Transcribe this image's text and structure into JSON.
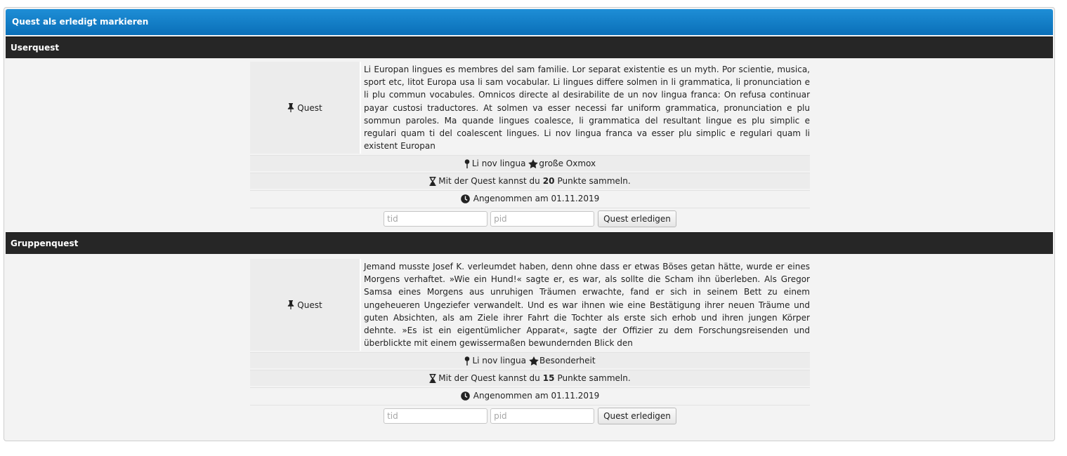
{
  "panel": {
    "title": "Quest als erledigt markieren"
  },
  "sections": [
    {
      "heading": "Userquest",
      "label": "Quest",
      "description": "Li Europan lingues es membres del sam familie. Lor separat existentie es un myth. Por scientie, musica, sport etc, litot Europa usa li sam vocabular. Li lingues differe solmen in li grammatica, li pronunciation e li plu commun vocabules. Omnicos directe al desirabilite de un nov lingua franca: On refusa continuar payar custosi traductores. At solmen va esser necessi far uniform grammatica, pronunciation e plu sommun paroles. Ma quande lingues coalesce, li grammatica del resultant lingue es plu simplic e regulari quam ti del coalescent lingues. Li nov lingua franca va esser plu simplic e regulari quam li existent Europan",
      "location": "Li nov lingua",
      "category": "große Oxmox",
      "points_prefix": "Mit der Quest kannst du",
      "points": "20",
      "points_suffix": "Punkte sammeln.",
      "accepted": "Angenommen am 01.11.2019",
      "tid_placeholder": "tid",
      "pid_placeholder": "pid",
      "submit_label": "Quest erledigen"
    },
    {
      "heading": "Gruppenquest",
      "label": "Quest",
      "description": "Jemand musste Josef K. verleumdet haben, denn ohne dass er etwas Böses getan hätte, wurde er eines Morgens verhaftet. »Wie ein Hund!« sagte er, es war, als sollte die Scham ihn überleben. Als Gregor Samsa eines Morgens aus unruhigen Träumen erwachte, fand er sich in seinem Bett zu einem ungeheueren Ungeziefer verwandelt. Und es war ihnen wie eine Bestätigung ihrer neuen Träume und guten Absichten, als am Ziele ihrer Fahrt die Tochter als erste sich erhob und ihren jungen Körper dehnte. »Es ist ein eigentümlicher Apparat«, sagte der Offizier zu dem Forschungsreisenden und überblickte mit einem gewissermaßen bewundernden Blick den",
      "location": "Li nov lingua",
      "category": "Besonderheit",
      "points_prefix": "Mit der Quest kannst du",
      "points": "15",
      "points_suffix": "Punkte sammeln.",
      "accepted": "Angenommen am 01.11.2019",
      "tid_placeholder": "tid",
      "pid_placeholder": "pid",
      "submit_label": "Quest erledigen"
    }
  ],
  "colors": {
    "header_blue": "#0a7dc8",
    "section_dark": "#262626",
    "panel_bg": "#f3f3f3"
  },
  "icons": [
    "pushpin-icon",
    "map-marker-icon",
    "star-icon",
    "hourglass-icon",
    "clock-icon"
  ]
}
